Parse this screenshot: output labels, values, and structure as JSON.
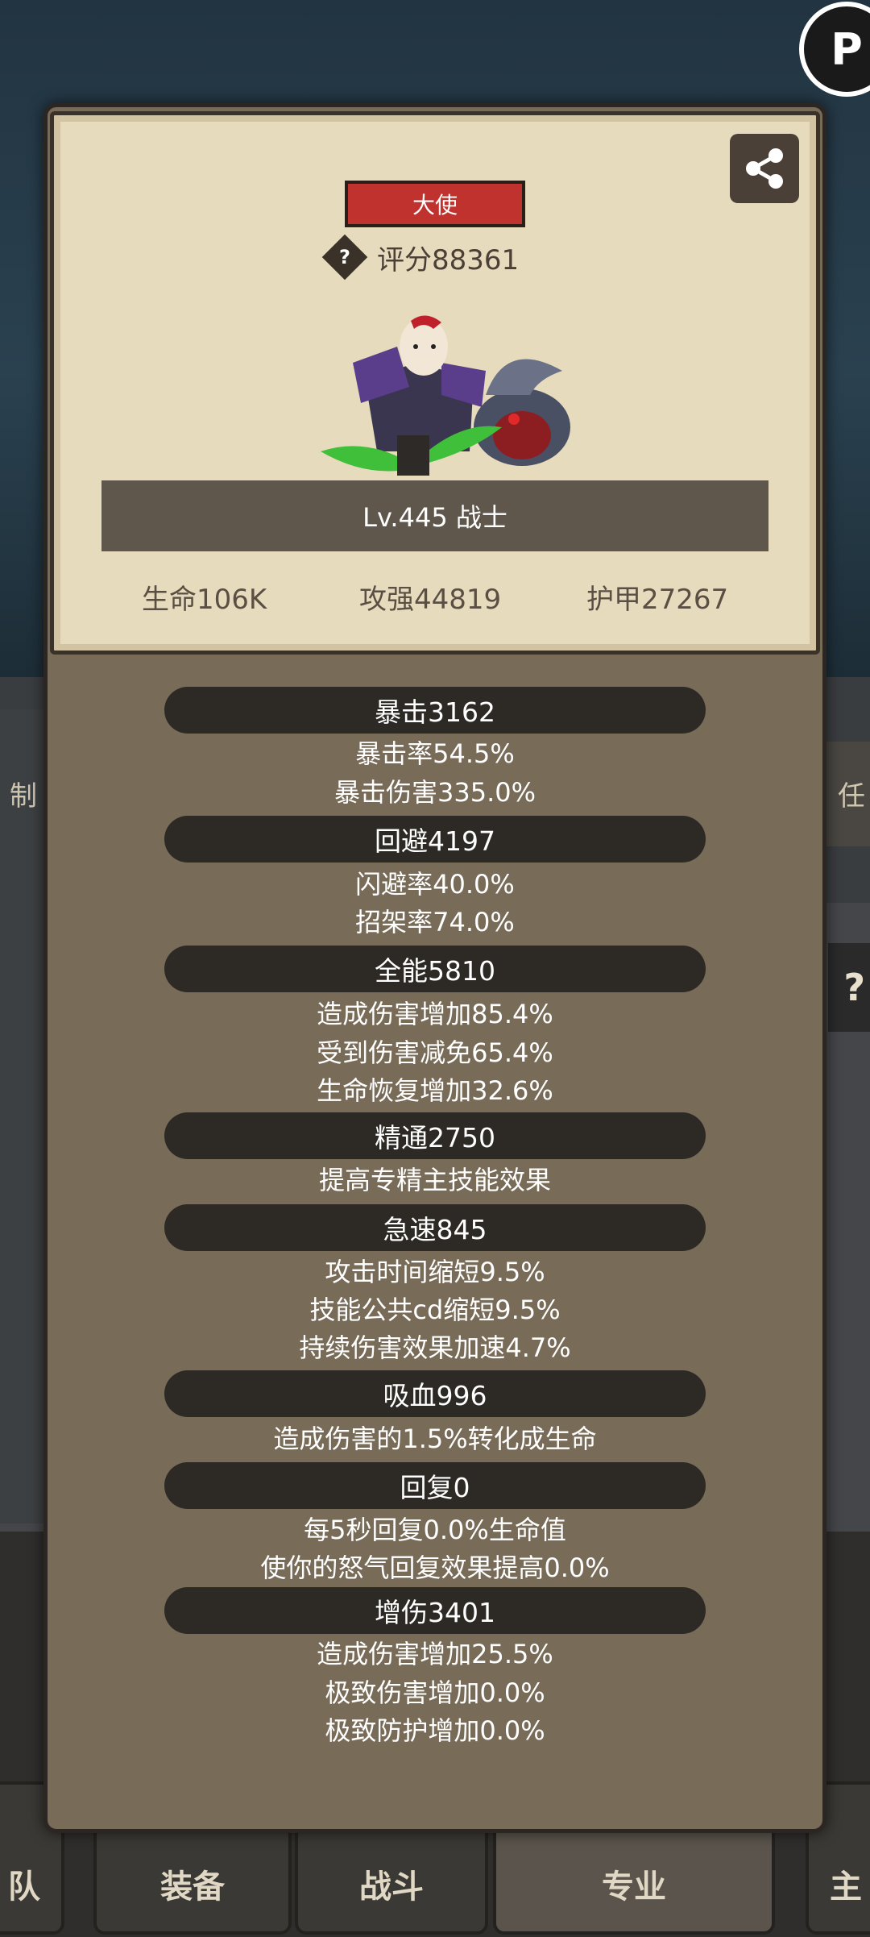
{
  "card": {
    "title_badge": "大使",
    "score": "评分88361",
    "level": "Lv.445 战士",
    "stats": {
      "life": "生命106K",
      "attack": "攻强44819",
      "armor": "护甲27267"
    }
  },
  "attributes": [
    {
      "head": "暴击3162",
      "lines": [
        "暴击率54.5%",
        "暴击伤害335.0%"
      ]
    },
    {
      "head": "回避4197",
      "lines": [
        "闪避率40.0%",
        "招架率74.0%"
      ]
    },
    {
      "head": "全能5810",
      "lines": [
        "造成伤害增加85.4%",
        "受到伤害减免65.4%",
        "生命恢复增加32.6%"
      ]
    },
    {
      "head": "精通2750",
      "lines": [
        "提高专精主技能效果"
      ]
    },
    {
      "head": "急速845",
      "lines": [
        "攻击时间缩短9.5%",
        "技能公共cd缩短9.5%",
        "持续伤害效果加速4.7%"
      ]
    },
    {
      "head": "吸血996",
      "lines": [
        "造成伤害的1.5%转化成生命"
      ]
    },
    {
      "head": "回复0",
      "lines": [
        "每5秒回复0.0%生命值",
        "使你的怒气回复效果提高0.0%"
      ]
    },
    {
      "head": "增伤3401",
      "lines": [
        "造成伤害增加25.5%",
        "极致伤害增加0.0%",
        "极致防护增加0.0%"
      ]
    }
  ],
  "background": {
    "left_partial": "制",
    "right_partial": "任",
    "right_help": "?",
    "corner_icon": "P",
    "tabs": [
      "队",
      "装备",
      "战斗",
      "专业",
      "主"
    ]
  },
  "colors": {
    "badge": "#c0322e",
    "card": "#e7dbbd",
    "panel": "#786b58",
    "pill": "#2d2925"
  }
}
